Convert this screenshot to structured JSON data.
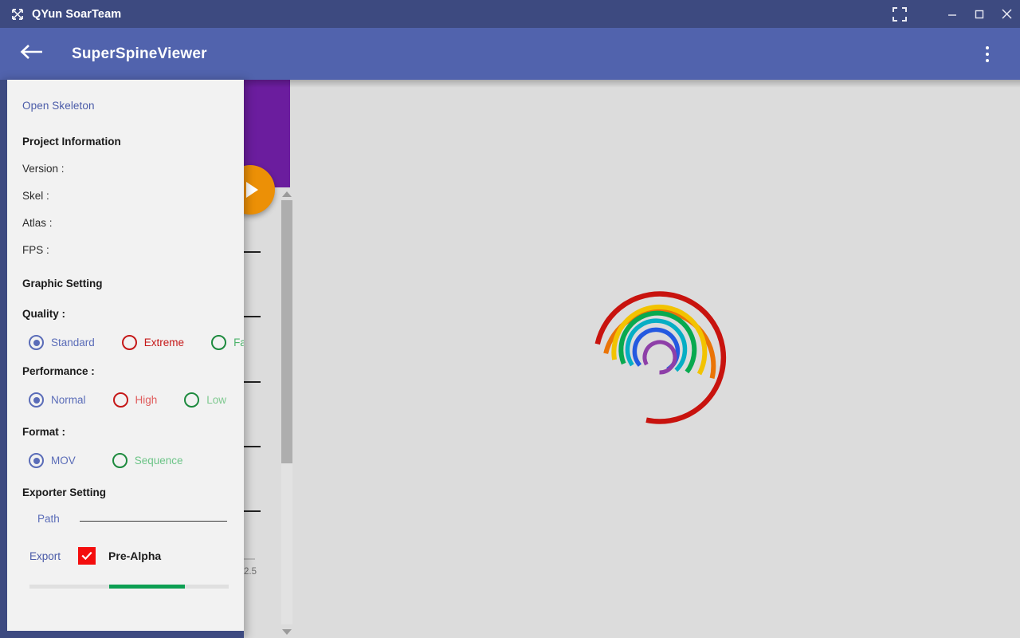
{
  "window": {
    "app_icon": "spine-skeleton-icon",
    "title": "QYun SoarTeam",
    "controls": {
      "fullscreen": "fullscreen-icon",
      "minimize": "minimize-icon",
      "maximize": "maximize-icon",
      "close": "close-icon"
    }
  },
  "appbar": {
    "back_icon": "back-arrow-icon",
    "title": "SuperSpineViewer",
    "overflow_icon": "more-vertical-icon"
  },
  "drawer": {
    "open_skeleton": "Open Skeleton",
    "project_information": {
      "heading": "Project Information",
      "fields": [
        {
          "label": "Version :",
          "value": ""
        },
        {
          "label": "Skel :",
          "value": ""
        },
        {
          "label": "Atlas :",
          "value": ""
        },
        {
          "label": "FPS :",
          "value": ""
        }
      ]
    },
    "graphic_setting": {
      "heading": "Graphic Setting",
      "quality": {
        "label": "Quality :",
        "selected": "Standard",
        "options": [
          {
            "label": "Standard",
            "color": "#5a6cb8",
            "selected": true
          },
          {
            "label": "Extreme",
            "color": "#c51818",
            "selected": false
          },
          {
            "label": "Fast",
            "color": "#1d8a3e",
            "selected": false
          }
        ]
      },
      "performance": {
        "label": "Performance :",
        "selected": "Normal",
        "options": [
          {
            "label": "Normal",
            "color": "#5a6cb8",
            "selected": true
          },
          {
            "label": "High",
            "color": "#c51818",
            "selected": false
          },
          {
            "label": "Low",
            "color": "#3fa45c",
            "selected": false
          }
        ]
      },
      "format": {
        "label": "Format :",
        "selected": "MOV",
        "options": [
          {
            "label": "MOV",
            "color": "#5a6cb8",
            "selected": true
          },
          {
            "label": "Sequence",
            "color": "#3fa45c",
            "selected": false
          }
        ]
      }
    },
    "exporter_setting": {
      "heading": "Exporter Setting",
      "path_label": "Path",
      "path_value": "",
      "path_placeholder": "",
      "export_label": "Export",
      "prealpha_label": "Pre-Alpha",
      "prealpha_checked": true,
      "checkbox_color": "#f40d0d",
      "progress_color": "#0d9f53",
      "progress_percent": 38
    }
  },
  "background_panel": {
    "purple_card_color": "#6b1d9e",
    "play_button": "play-icon",
    "play_button_color": "#ec9006",
    "axis_tick_label": "2.5",
    "scrollbar": {
      "up_arrow": "scroll-up-icon",
      "down_arrow": "scroll-down-icon"
    }
  },
  "viewer": {
    "background_color": "#dcdcdc",
    "logo_name": "rainbow-spiral-logo",
    "logo_arcs": [
      {
        "color": "#c8130e",
        "radius": 80,
        "start_deg": 168,
        "sweep_deg": 265
      },
      {
        "color": "#ea7407",
        "radius": 68,
        "start_deg": 176,
        "sweep_deg": 250
      },
      {
        "color": "#f2c300",
        "radius": 57,
        "start_deg": 183,
        "sweep_deg": 234
      },
      {
        "color": "#08a94f",
        "radius": 46,
        "start_deg": 190,
        "sweep_deg": 218
      },
      {
        "color": "#06aec4",
        "radius": 36,
        "start_deg": 196,
        "sweep_deg": 200
      },
      {
        "color": "#2459e0",
        "radius": 27,
        "start_deg": 202,
        "sweep_deg": 184
      },
      {
        "color": "#8e3fa8",
        "radius": 19,
        "start_deg": 209,
        "sweep_deg": 168
      }
    ]
  }
}
